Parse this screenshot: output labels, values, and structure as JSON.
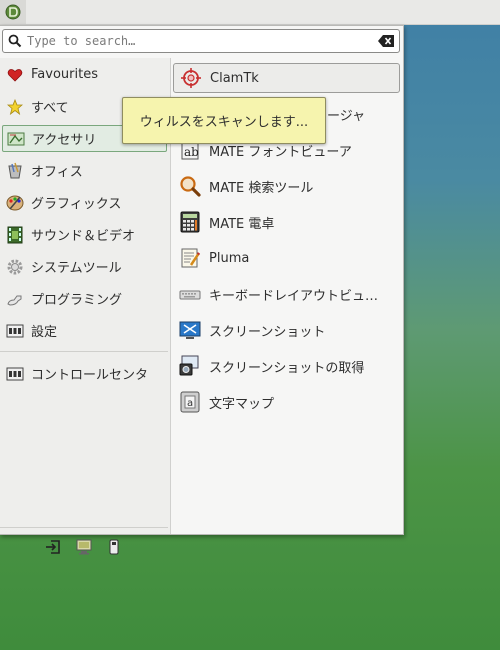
{
  "search": {
    "placeholder": "Type to search…"
  },
  "categories": [
    {
      "label": "Favourites"
    },
    {
      "label": "すべて"
    },
    {
      "label": "アクセサリ"
    },
    {
      "label": "オフィス"
    },
    {
      "label": "グラフィックス"
    },
    {
      "label": "サウンド＆ビデオ"
    },
    {
      "label": "システムツール"
    },
    {
      "label": "プログラミング"
    },
    {
      "label": "設定"
    },
    {
      "label": "コントロールセンタ"
    }
  ],
  "apps": [
    {
      "label": "ClamTk"
    },
    {
      "label": "ージャ"
    },
    {
      "label": "MATE フォントビューア"
    },
    {
      "label": "MATE 検索ツール"
    },
    {
      "label": "MATE 電卓"
    },
    {
      "label": "Pluma"
    },
    {
      "label": "キーボードレイアウトビュ…"
    },
    {
      "label": "スクリーンショット"
    },
    {
      "label": "スクリーンショットの取得"
    },
    {
      "label": "文字マップ"
    }
  ],
  "tooltip": {
    "text": "ウィルスをスキャンします..."
  },
  "bottom_buttons": [
    "logout-icon",
    "lock-screen-icon",
    "shutdown-icon"
  ]
}
